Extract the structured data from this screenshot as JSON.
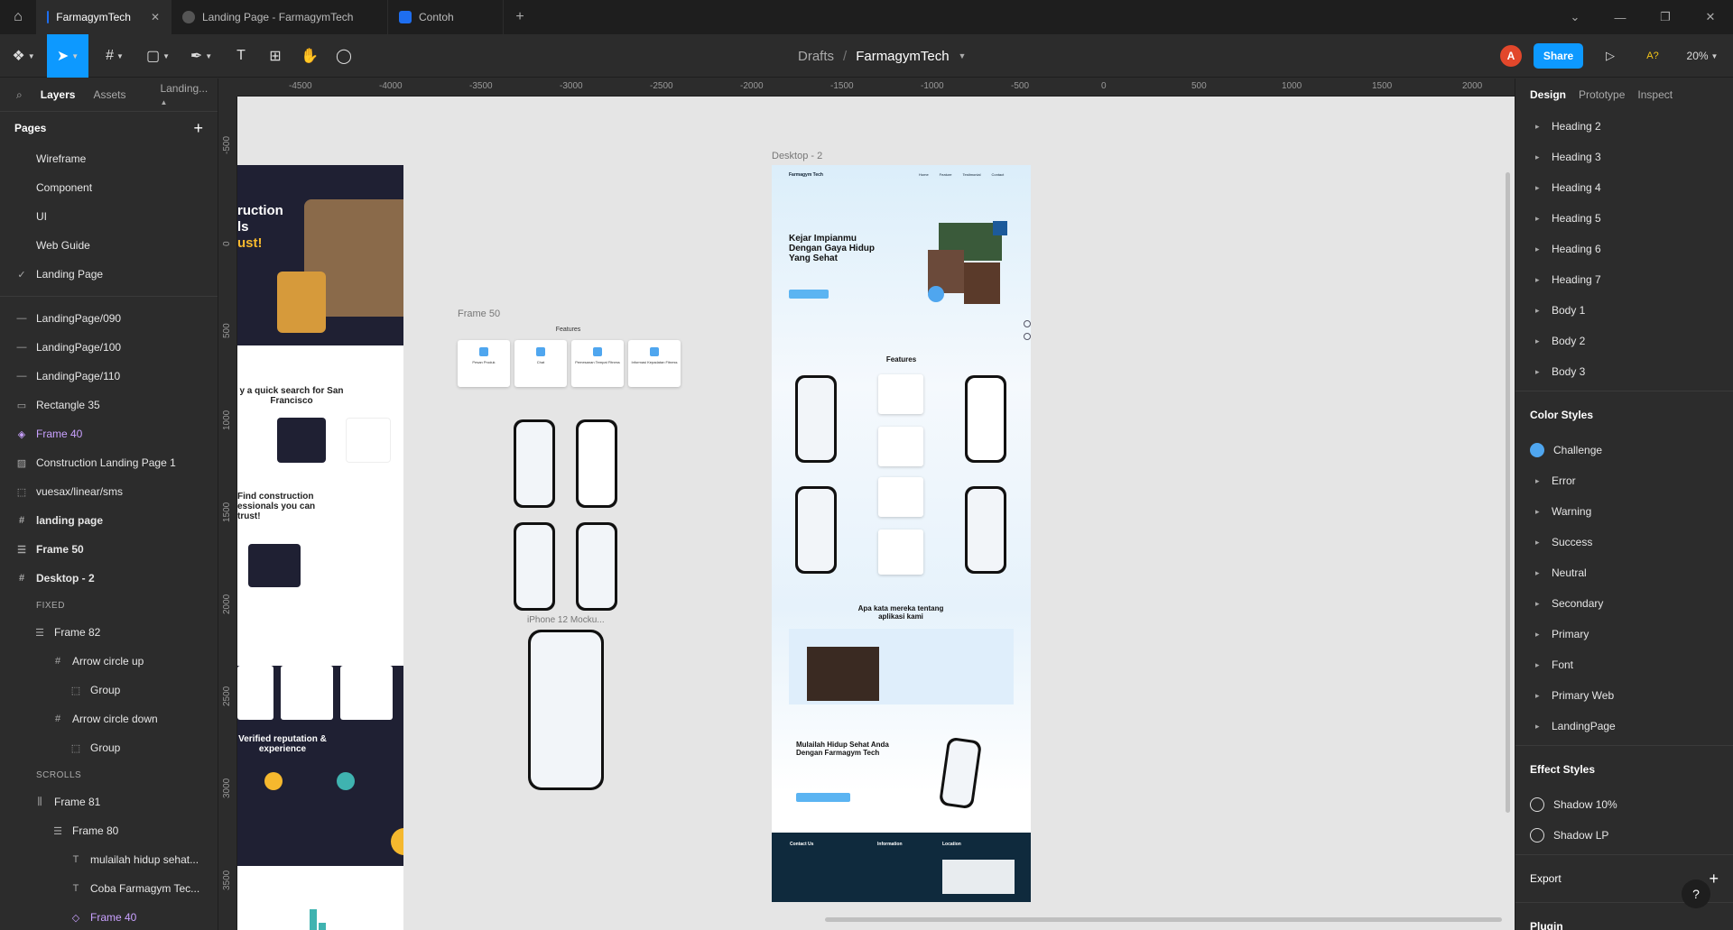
{
  "tabs": [
    {
      "label": "FarmagymTech",
      "active": true
    },
    {
      "label": "Landing Page - FarmagymTech",
      "active": false
    },
    {
      "label": "Contoh",
      "active": false
    }
  ],
  "breadcrumb": {
    "parent": "Drafts",
    "sep": "/",
    "file": "FarmagymTech"
  },
  "toolbar": {
    "avatar": "A",
    "share": "Share",
    "zoom": "20%",
    "a11y": "A?"
  },
  "left": {
    "tabs": [
      "Layers",
      "Assets",
      "Landing..."
    ],
    "pages_title": "Pages",
    "pages": [
      "Wireframe",
      "Component",
      "UI",
      "Web Guide",
      "Landing Page"
    ],
    "fixed_label": "FIXED",
    "scrolls_label": "SCROLLS",
    "layers": [
      {
        "label": "LandingPage/090",
        "icon": "—",
        "indent": 0
      },
      {
        "label": "LandingPage/100",
        "icon": "—",
        "indent": 0
      },
      {
        "label": "LandingPage/110",
        "icon": "—",
        "indent": 0
      },
      {
        "label": "Rectangle 35",
        "icon": "▭",
        "indent": 0
      },
      {
        "label": "Frame 40",
        "icon": "◈",
        "indent": 0,
        "purple": true
      },
      {
        "label": "Construction Landing Page 1",
        "icon": "▨",
        "indent": 0
      },
      {
        "label": "vuesax/linear/sms",
        "icon": "⬚",
        "indent": 0
      },
      {
        "label": "landing page",
        "icon": "#",
        "indent": 0,
        "bold": true
      },
      {
        "label": "Frame 50",
        "icon": "☰",
        "indent": 0,
        "bold": true
      },
      {
        "label": "Desktop - 2",
        "icon": "#",
        "indent": 0,
        "bold": true
      }
    ],
    "fixed_layers": [
      {
        "label": "Frame 82",
        "icon": "☰",
        "indent": 1
      },
      {
        "label": "Arrow circle up",
        "icon": "#",
        "indent": 2
      },
      {
        "label": "Group",
        "icon": "⬚",
        "indent": 3
      },
      {
        "label": "Arrow circle down",
        "icon": "#",
        "indent": 2
      },
      {
        "label": "Group",
        "icon": "⬚",
        "indent": 3
      }
    ],
    "scroll_layers": [
      {
        "label": "Frame 81",
        "icon": "⫼",
        "indent": 1
      },
      {
        "label": "Frame 80",
        "icon": "☰",
        "indent": 2
      },
      {
        "label": "mulailah hidup sehat...",
        "icon": "T",
        "indent": 3
      },
      {
        "label": "Coba Farmagym Tec...",
        "icon": "T",
        "indent": 3
      },
      {
        "label": "Frame 40",
        "icon": "◇",
        "indent": 3,
        "purple": true
      }
    ]
  },
  "ruler": {
    "x": [
      "-4500",
      "-4000",
      "-3500",
      "-3000",
      "-2500",
      "-2000",
      "-1500",
      "-1000",
      "-500",
      "0",
      "500",
      "1000",
      "1500",
      "2000"
    ],
    "y": [
      "-500",
      "0",
      "500",
      "1000",
      "1500",
      "2000",
      "2500",
      "3000",
      "3500"
    ]
  },
  "canvas": {
    "frame50_label": "Frame 50",
    "desktop2_label": "Desktop - 2",
    "iphone_label": "iPhone 12 Mocku...",
    "features_title": "Features",
    "feature_cards": [
      "Pesan Produk",
      "Chat",
      "Pemesanan Tempat Fitness",
      "Informasi Kepadatan Fitness"
    ],
    "hero": "Kejar Impianmu Dengan Gaya Hidup Yang Sehat",
    "brand": "Farmagym Tech",
    "nav": [
      "Home",
      "Feature",
      "Testimonial",
      "Contact"
    ],
    "testimonial_title": "Apa kata mereka tentang aplikasi kami",
    "cta_title": "Mulailah Hidup Sehat Anda Dengan Farmagym Tech",
    "footer_cols": [
      "Contact Us",
      "Information",
      "Location"
    ],
    "left_frame": {
      "hero1": "ruction",
      "hero2": "ls",
      "hero3": "ust!",
      "search": "y a quick search for San Francisco",
      "find": "Find construction essionals you can trust!",
      "verified": "Verified reputation & experience"
    }
  },
  "right": {
    "tabs": [
      "Design",
      "Prototype",
      "Inspect"
    ],
    "text_styles": [
      "Heading 2",
      "Heading 3",
      "Heading 4",
      "Heading 5",
      "Heading 6",
      "Heading 7",
      "Body 1",
      "Body 2",
      "Body 3"
    ],
    "color_title": "Color Styles",
    "colors": [
      "Challenge",
      "Error",
      "Warning",
      "Success",
      "Neutral",
      "Secondary",
      "Primary",
      "Font",
      "Primary Web",
      "LandingPage"
    ],
    "effect_title": "Effect Styles",
    "effects": [
      "Shadow 10%",
      "Shadow LP"
    ],
    "export": "Export",
    "plugin": "Plugin"
  }
}
